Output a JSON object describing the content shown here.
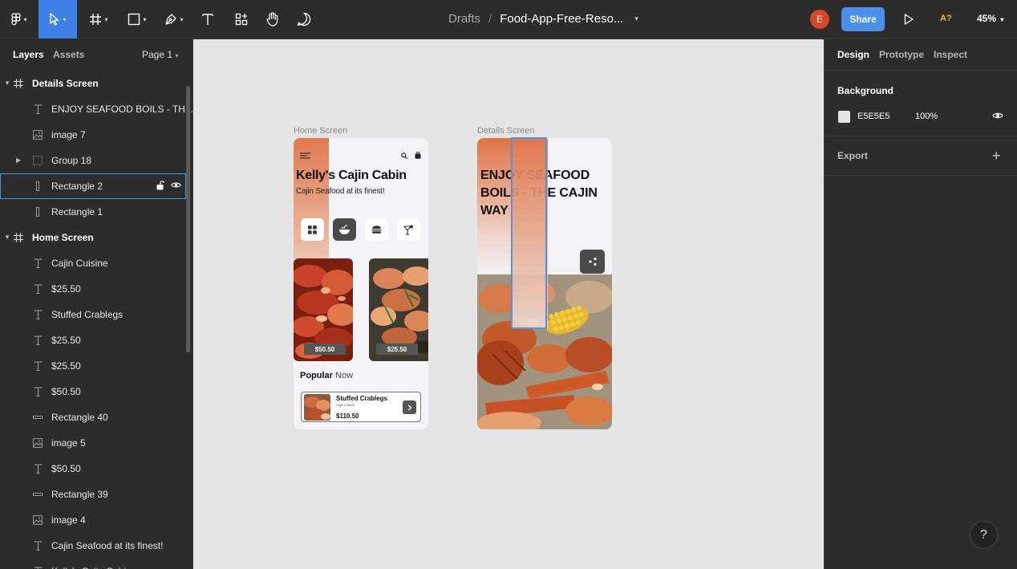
{
  "toolbar": {
    "breadcrumb_root": "Drafts",
    "breadcrumb_sep": "/",
    "file_name": "Food-App-Free-Reso...",
    "avatar_initial": "E",
    "share_label": "Share",
    "a11y_label": "A?",
    "zoom": "45%"
  },
  "left_panel": {
    "tabs": [
      "Layers",
      "Assets"
    ],
    "page_selector": "Page 1",
    "layers": [
      {
        "name": "Details Screen",
        "type": "frame",
        "indent": 0,
        "expandable": true
      },
      {
        "name": "ENJOY SEAFOOD BOILS - TH...",
        "type": "text",
        "indent": 1
      },
      {
        "name": "image 7",
        "type": "image",
        "indent": 1
      },
      {
        "name": "Group 18",
        "type": "group",
        "indent": 1,
        "expandable": true
      },
      {
        "name": "Rectangle 2",
        "type": "rect-v",
        "indent": 1,
        "selected": true
      },
      {
        "name": "Rectangle 1",
        "type": "rect-v",
        "indent": 1
      },
      {
        "name": "Home Screen",
        "type": "frame",
        "indent": 0,
        "expandable": true
      },
      {
        "name": "Cajin Cuisine",
        "type": "text",
        "indent": 1
      },
      {
        "name": "$25.50",
        "type": "text",
        "indent": 1
      },
      {
        "name": "Stuffed Crablegs",
        "type": "text",
        "indent": 1
      },
      {
        "name": "$25.50",
        "type": "text",
        "indent": 1
      },
      {
        "name": "$25.50",
        "type": "text",
        "indent": 1
      },
      {
        "name": "$50.50",
        "type": "text",
        "indent": 1
      },
      {
        "name": "Rectangle 40",
        "type": "rect-h",
        "indent": 1
      },
      {
        "name": "image 5",
        "type": "image",
        "indent": 1
      },
      {
        "name": "$50.50",
        "type": "text",
        "indent": 1
      },
      {
        "name": "Rectangle 39",
        "type": "rect-h",
        "indent": 1
      },
      {
        "name": "image 4",
        "type": "image",
        "indent": 1
      },
      {
        "name": "Cajin Seafood at its finest!",
        "type": "text",
        "indent": 1
      },
      {
        "name": "Kelly's Cajin Cabin",
        "type": "text",
        "indent": 1
      }
    ]
  },
  "canvas": {
    "home_label": "Home Screen",
    "details_label": "Details Screen",
    "home": {
      "title": "Kelly's Cajin Cabin",
      "subtitle": "Cajin Seafood at its finest!",
      "price_1": "$50.50",
      "price_2": "$25.50",
      "popular_bold": "Popular",
      "popular_rest": " Now",
      "popular_item": {
        "name": "Stuffed Crablegs",
        "category": "Cajin Cuisine",
        "price": "$110.50"
      }
    },
    "details": {
      "title": "ENJOY SEAFOOD BOILS - THE CAJIN WAY"
    }
  },
  "right_panel": {
    "tabs": [
      "Design",
      "Prototype",
      "Inspect"
    ],
    "background_title": "Background",
    "background_hex": "E5E5E5",
    "background_opacity": "100%",
    "background_color": "#e5e5e5",
    "export_title": "Export"
  },
  "help_label": "?"
}
